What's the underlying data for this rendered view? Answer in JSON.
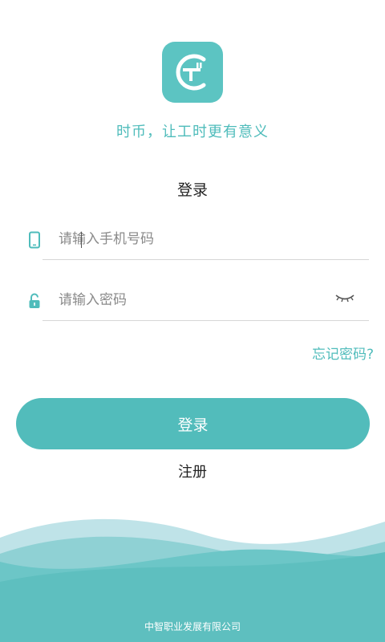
{
  "app": {
    "logo_icon": "ct-logo-icon",
    "slogan": "时币，让工时更有意义",
    "heading": "登录"
  },
  "form": {
    "phone": {
      "placeholder": "请输入手机号码",
      "icon": "phone-icon"
    },
    "password": {
      "placeholder": "请输入密码",
      "icon": "lock-icon",
      "toggle_icon": "eye-closed-icon"
    },
    "forgot_label": "忘记密码?",
    "login_label": "登录",
    "register_label": "注册"
  },
  "footer": {
    "company": "中智职业发展有限公司"
  },
  "colors": {
    "accent": "#52bcbb",
    "logo_bg": "#5cc4c2",
    "wave_light": "#bfe3e8",
    "wave_mid": "#8fd1d4",
    "wave_dark": "#5ebfbf"
  }
}
